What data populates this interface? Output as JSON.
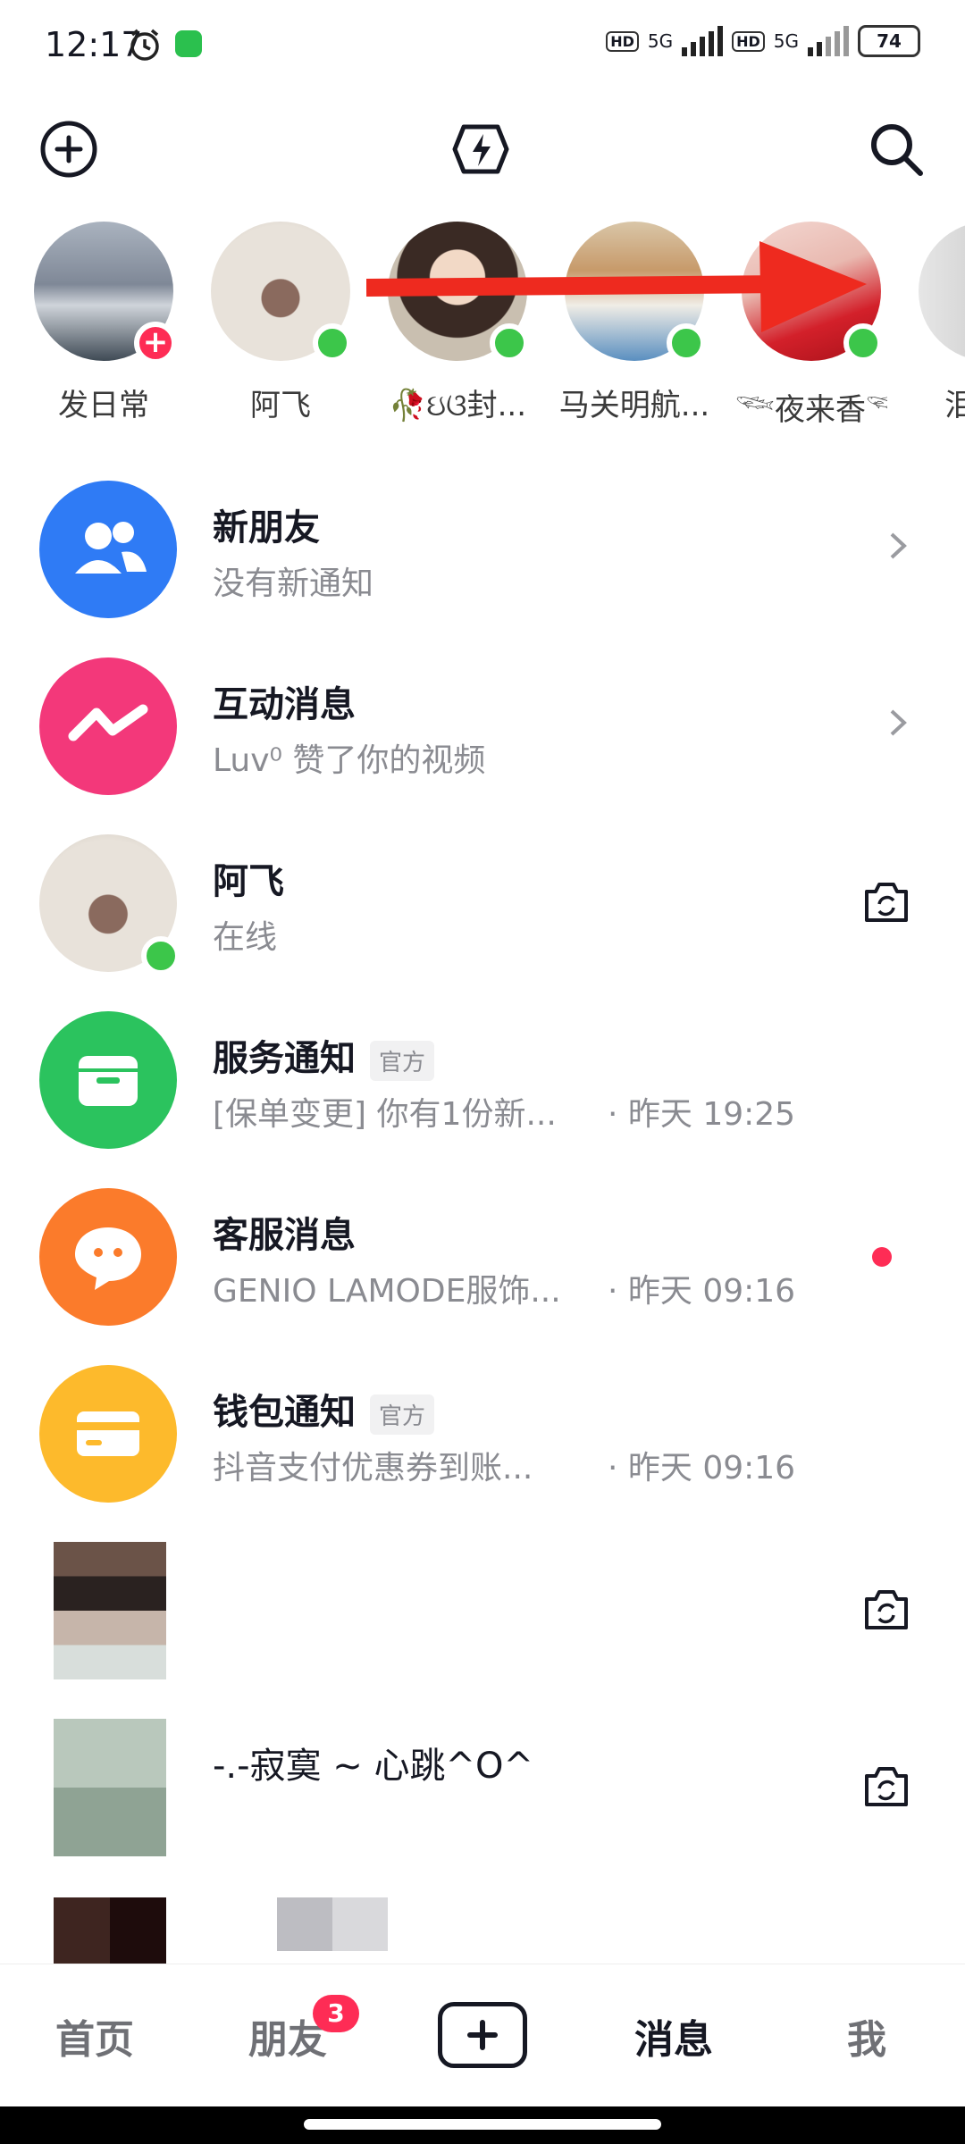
{
  "status_bar": {
    "time": "12:17",
    "net1": "5G",
    "net2": "5G",
    "hd": "HD",
    "battery": "74"
  },
  "header": {
    "add_icon": "plus-circle-icon",
    "center_icon": "lightning-icon",
    "search_icon": "search-icon"
  },
  "stories": [
    {
      "name": "发日常",
      "badge": "+"
    },
    {
      "name": "阿飞"
    },
    {
      "name": "🥀ઇଓ封..."
    },
    {
      "name": "马关明航..."
    },
    {
      "name": "𓆝夜来香𓆝"
    },
    {
      "name": "泪"
    }
  ],
  "list": [
    {
      "title": "新朋友",
      "sub": "没有新通知",
      "trailing": "chevron"
    },
    {
      "title": "互动消息",
      "sub": "Luv⁰ 赞了你的视频",
      "trailing": "chevron"
    },
    {
      "title": "阿飞",
      "sub": "在线",
      "trailing": "camera"
    },
    {
      "title": "服务通知",
      "official": "官方",
      "sub": "[保单变更] 你有1份新...",
      "time": "· 昨天 19:25"
    },
    {
      "title": "客服消息",
      "sub": "GENIO LAMODE服饰...",
      "time": "· 昨天 09:16",
      "trailing": "dot"
    },
    {
      "title": "钱包通知",
      "official": "官方",
      "sub": "抖音支付优惠券到账...",
      "time": "· 昨天 09:16"
    },
    {
      "title": "",
      "sub": "",
      "trailing": "camera"
    },
    {
      "title": "-.-寂寞 ~ 心跳^O^",
      "sub": "",
      "trailing": "camera"
    }
  ],
  "nav": {
    "home": "首页",
    "friends": "朋友",
    "friends_badge": "3",
    "messages": "消息",
    "me": "我"
  },
  "colors": {
    "accent": "#fe2c55",
    "online": "#3cc64a",
    "blue": "#2f7bf5",
    "pink": "#f3387a",
    "green": "#2bc35e",
    "orange": "#fb7b2b",
    "yellow": "#fdba2c"
  }
}
